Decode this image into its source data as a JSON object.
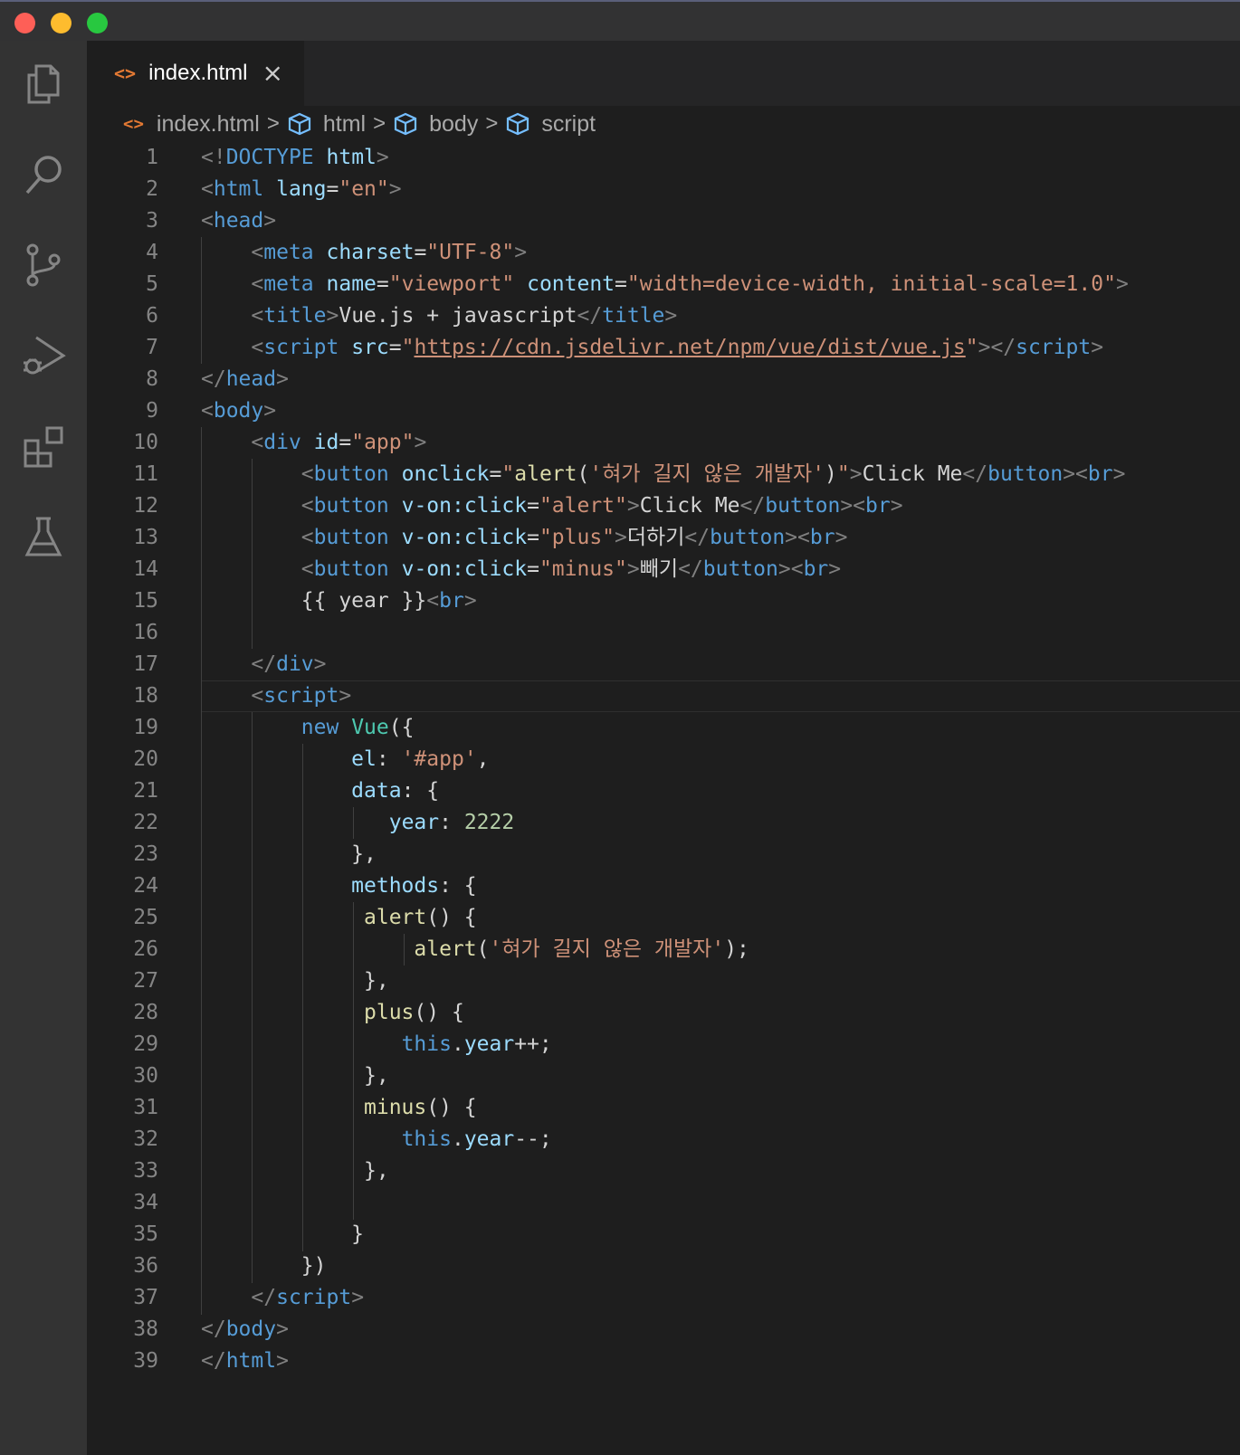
{
  "window": {
    "traffic_lights": [
      "close",
      "minimize",
      "maximize"
    ]
  },
  "activity_bar": {
    "icons": [
      "explorer-icon",
      "search-icon",
      "source-control-icon",
      "run-debug-icon",
      "extensions-icon",
      "testing-icon"
    ]
  },
  "tab": {
    "filename": "index.html",
    "file_icon": "<>",
    "close": "×"
  },
  "breadcrumb": {
    "file_icon": "<>",
    "file": "index.html",
    "items": [
      "html",
      "body",
      "script"
    ],
    "sep": ">"
  },
  "editor": {
    "lines": [
      [
        [
          "br",
          "<!"
        ],
        [
          "tag",
          "DOCTYPE"
        ],
        [
          "txt",
          " "
        ],
        [
          "attr",
          "html"
        ],
        [
          "br",
          ">"
        ]
      ],
      [
        [
          "br",
          "<"
        ],
        [
          "tag",
          "html"
        ],
        [
          "txt",
          " "
        ],
        [
          "attr",
          "lang"
        ],
        [
          "txt",
          "="
        ],
        [
          "str",
          "\"en\""
        ],
        [
          "br",
          ">"
        ]
      ],
      [
        [
          "br",
          "<"
        ],
        [
          "tag",
          "head"
        ],
        [
          "br",
          ">"
        ]
      ],
      [
        [
          "txt",
          "    "
        ],
        [
          "br",
          "<"
        ],
        [
          "tag",
          "meta"
        ],
        [
          "txt",
          " "
        ],
        [
          "attr",
          "charset"
        ],
        [
          "txt",
          "="
        ],
        [
          "str",
          "\"UTF-8\""
        ],
        [
          "br",
          ">"
        ]
      ],
      [
        [
          "txt",
          "    "
        ],
        [
          "br",
          "<"
        ],
        [
          "tag",
          "meta"
        ],
        [
          "txt",
          " "
        ],
        [
          "attr",
          "name"
        ],
        [
          "txt",
          "="
        ],
        [
          "str",
          "\"viewport\""
        ],
        [
          "txt",
          " "
        ],
        [
          "attr",
          "content"
        ],
        [
          "txt",
          "="
        ],
        [
          "str",
          "\"width=device-width, initial-scale=1.0\""
        ],
        [
          "br",
          ">"
        ]
      ],
      [
        [
          "txt",
          "    "
        ],
        [
          "br",
          "<"
        ],
        [
          "tag",
          "title"
        ],
        [
          "br",
          ">"
        ],
        [
          "txt",
          "Vue.js + javascript"
        ],
        [
          "br",
          "</"
        ],
        [
          "tag",
          "title"
        ],
        [
          "br",
          ">"
        ]
      ],
      [
        [
          "txt",
          "    "
        ],
        [
          "br",
          "<"
        ],
        [
          "tag",
          "script"
        ],
        [
          "txt",
          " "
        ],
        [
          "attr",
          "src"
        ],
        [
          "txt",
          "="
        ],
        [
          "str",
          "\""
        ],
        [
          "link",
          "https://cdn.jsdelivr.net/npm/vue/dist/vue.js"
        ],
        [
          "str",
          "\""
        ],
        [
          "br",
          "></"
        ],
        [
          "tag",
          "script"
        ],
        [
          "br",
          ">"
        ]
      ],
      [
        [
          "br",
          "</"
        ],
        [
          "tag",
          "head"
        ],
        [
          "br",
          ">"
        ]
      ],
      [
        [
          "br",
          "<"
        ],
        [
          "tag",
          "body"
        ],
        [
          "br",
          ">"
        ]
      ],
      [
        [
          "txt",
          "    "
        ],
        [
          "br",
          "<"
        ],
        [
          "tag",
          "div"
        ],
        [
          "txt",
          " "
        ],
        [
          "attr",
          "id"
        ],
        [
          "txt",
          "="
        ],
        [
          "str",
          "\"app\""
        ],
        [
          "br",
          ">"
        ]
      ],
      [
        [
          "txt",
          "        "
        ],
        [
          "br",
          "<"
        ],
        [
          "tag",
          "button"
        ],
        [
          "txt",
          " "
        ],
        [
          "attr",
          "onclick"
        ],
        [
          "txt",
          "="
        ],
        [
          "str",
          "\""
        ],
        [
          "fn",
          "alert"
        ],
        [
          "txt",
          "("
        ],
        [
          "str",
          "'혀가 길지 않은 개발자'"
        ],
        [
          "txt",
          ")"
        ],
        [
          "str",
          "\""
        ],
        [
          "br",
          ">"
        ],
        [
          "txt",
          "Click Me"
        ],
        [
          "br",
          "</"
        ],
        [
          "tag",
          "button"
        ],
        [
          "br",
          "><"
        ],
        [
          "tag",
          "br"
        ],
        [
          "br",
          ">"
        ]
      ],
      [
        [
          "txt",
          "        "
        ],
        [
          "br",
          "<"
        ],
        [
          "tag",
          "button"
        ],
        [
          "txt",
          " "
        ],
        [
          "attr",
          "v-on:click"
        ],
        [
          "txt",
          "="
        ],
        [
          "str",
          "\"alert\""
        ],
        [
          "br",
          ">"
        ],
        [
          "txt",
          "Click Me"
        ],
        [
          "br",
          "</"
        ],
        [
          "tag",
          "button"
        ],
        [
          "br",
          "><"
        ],
        [
          "tag",
          "br"
        ],
        [
          "br",
          ">"
        ]
      ],
      [
        [
          "txt",
          "        "
        ],
        [
          "br",
          "<"
        ],
        [
          "tag",
          "button"
        ],
        [
          "txt",
          " "
        ],
        [
          "attr",
          "v-on:click"
        ],
        [
          "txt",
          "="
        ],
        [
          "str",
          "\"plus\""
        ],
        [
          "br",
          ">"
        ],
        [
          "txt",
          "더하기"
        ],
        [
          "br",
          "</"
        ],
        [
          "tag",
          "button"
        ],
        [
          "br",
          "><"
        ],
        [
          "tag",
          "br"
        ],
        [
          "br",
          ">"
        ]
      ],
      [
        [
          "txt",
          "        "
        ],
        [
          "br",
          "<"
        ],
        [
          "tag",
          "button"
        ],
        [
          "txt",
          " "
        ],
        [
          "attr",
          "v-on:click"
        ],
        [
          "txt",
          "="
        ],
        [
          "str",
          "\"minus\""
        ],
        [
          "br",
          ">"
        ],
        [
          "txt",
          "빼기"
        ],
        [
          "br",
          "</"
        ],
        [
          "tag",
          "button"
        ],
        [
          "br",
          "><"
        ],
        [
          "tag",
          "br"
        ],
        [
          "br",
          ">"
        ]
      ],
      [
        [
          "txt",
          "        {{ year }}"
        ],
        [
          "br",
          "<"
        ],
        [
          "tag",
          "br"
        ],
        [
          "br",
          ">"
        ]
      ],
      [],
      [
        [
          "txt",
          "    "
        ],
        [
          "br",
          "</"
        ],
        [
          "tag",
          "div"
        ],
        [
          "br",
          ">"
        ]
      ],
      [
        [
          "txt",
          "    "
        ],
        [
          "br",
          "<"
        ],
        [
          "tag",
          "script"
        ],
        [
          "br",
          ">"
        ]
      ],
      [
        [
          "txt",
          "        "
        ],
        [
          "kw",
          "new"
        ],
        [
          "txt",
          " "
        ],
        [
          "cls",
          "Vue"
        ],
        [
          "txt",
          "({"
        ]
      ],
      [
        [
          "txt",
          "            "
        ],
        [
          "prop",
          "el"
        ],
        [
          "txt",
          ": "
        ],
        [
          "str",
          "'#app'"
        ],
        [
          "txt",
          ","
        ]
      ],
      [
        [
          "txt",
          "            "
        ],
        [
          "prop",
          "data"
        ],
        [
          "txt",
          ": {"
        ]
      ],
      [
        [
          "txt",
          "               "
        ],
        [
          "prop",
          "year"
        ],
        [
          "txt",
          ": "
        ],
        [
          "num",
          "2222"
        ]
      ],
      [
        [
          "txt",
          "            },"
        ]
      ],
      [
        [
          "txt",
          "            "
        ],
        [
          "prop",
          "methods"
        ],
        [
          "txt",
          ": {"
        ]
      ],
      [
        [
          "txt",
          "             "
        ],
        [
          "fn",
          "alert"
        ],
        [
          "txt",
          "() {"
        ]
      ],
      [
        [
          "txt",
          "                 "
        ],
        [
          "fn",
          "alert"
        ],
        [
          "txt",
          "("
        ],
        [
          "str",
          "'혀가 길지 않은 개발자'"
        ],
        [
          "txt",
          ");"
        ]
      ],
      [
        [
          "txt",
          "             },"
        ]
      ],
      [
        [
          "txt",
          "             "
        ],
        [
          "fn",
          "plus"
        ],
        [
          "txt",
          "() {"
        ]
      ],
      [
        [
          "txt",
          "                "
        ],
        [
          "kw",
          "this"
        ],
        [
          "txt",
          "."
        ],
        [
          "prop",
          "year"
        ],
        [
          "txt",
          "++;"
        ]
      ],
      [
        [
          "txt",
          "             },"
        ]
      ],
      [
        [
          "txt",
          "             "
        ],
        [
          "fn",
          "minus"
        ],
        [
          "txt",
          "() {"
        ]
      ],
      [
        [
          "txt",
          "                "
        ],
        [
          "kw",
          "this"
        ],
        [
          "txt",
          "."
        ],
        [
          "prop",
          "year"
        ],
        [
          "txt",
          "--;"
        ]
      ],
      [
        [
          "txt",
          "             },"
        ]
      ],
      [],
      [
        [
          "txt",
          "            }"
        ]
      ],
      [
        [
          "txt",
          "        })"
        ]
      ],
      [
        [
          "txt",
          "    "
        ],
        [
          "br",
          "</"
        ],
        [
          "tag",
          "script"
        ],
        [
          "br",
          ">"
        ]
      ],
      [
        [
          "br",
          "</"
        ],
        [
          "tag",
          "body"
        ],
        [
          "br",
          ">"
        ]
      ],
      [
        [
          "br",
          "</"
        ],
        [
          "tag",
          "html"
        ],
        [
          "br",
          ">"
        ]
      ]
    ]
  }
}
